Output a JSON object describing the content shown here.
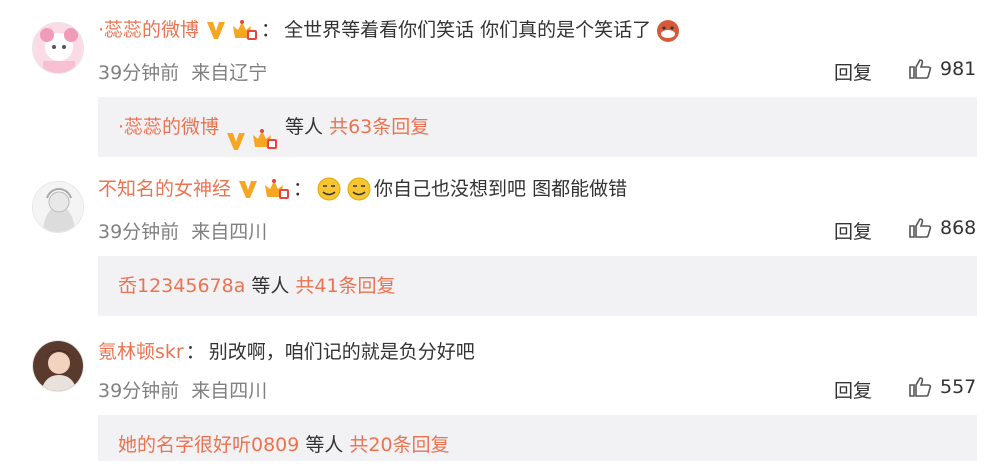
{
  "comments": [
    {
      "username": "·蕊蕊的微博",
      "content": "全世界等着看你们笑话 你们真的是个笑话了",
      "time": "39分钟前",
      "location": "来自辽宁",
      "reply_label": "回复",
      "likes": "981",
      "sub": {
        "user": "·蕊蕊的微博",
        "mid": "等人",
        "total": "共63条回复"
      }
    },
    {
      "username": "不知名的女神经",
      "content": "你自己也没想到吧 图都能做错",
      "time": "39分钟前",
      "location": "来自四川",
      "reply_label": "回复",
      "likes": "868",
      "sub": {
        "user": "岙12345678a",
        "mid": "等人",
        "total": "共41条回复"
      }
    },
    {
      "username": "氪林顿skr",
      "content": "别改啊，咱们记的就是负分好吧",
      "time": "39分钟前",
      "location": "来自四川",
      "reply_label": "回复",
      "likes": "557",
      "sub": {
        "user": "她的名字很好听0809",
        "mid": "等人",
        "total": "共20条回复"
      }
    }
  ],
  "colors": {
    "accent": "#eb7350",
    "vip": "#f5a623",
    "sub_bg": "#f2f2f5"
  },
  "icons": [
    "vip-v-icon",
    "crown-badge-icon",
    "emoji-icon",
    "thumbs-up-icon"
  ]
}
